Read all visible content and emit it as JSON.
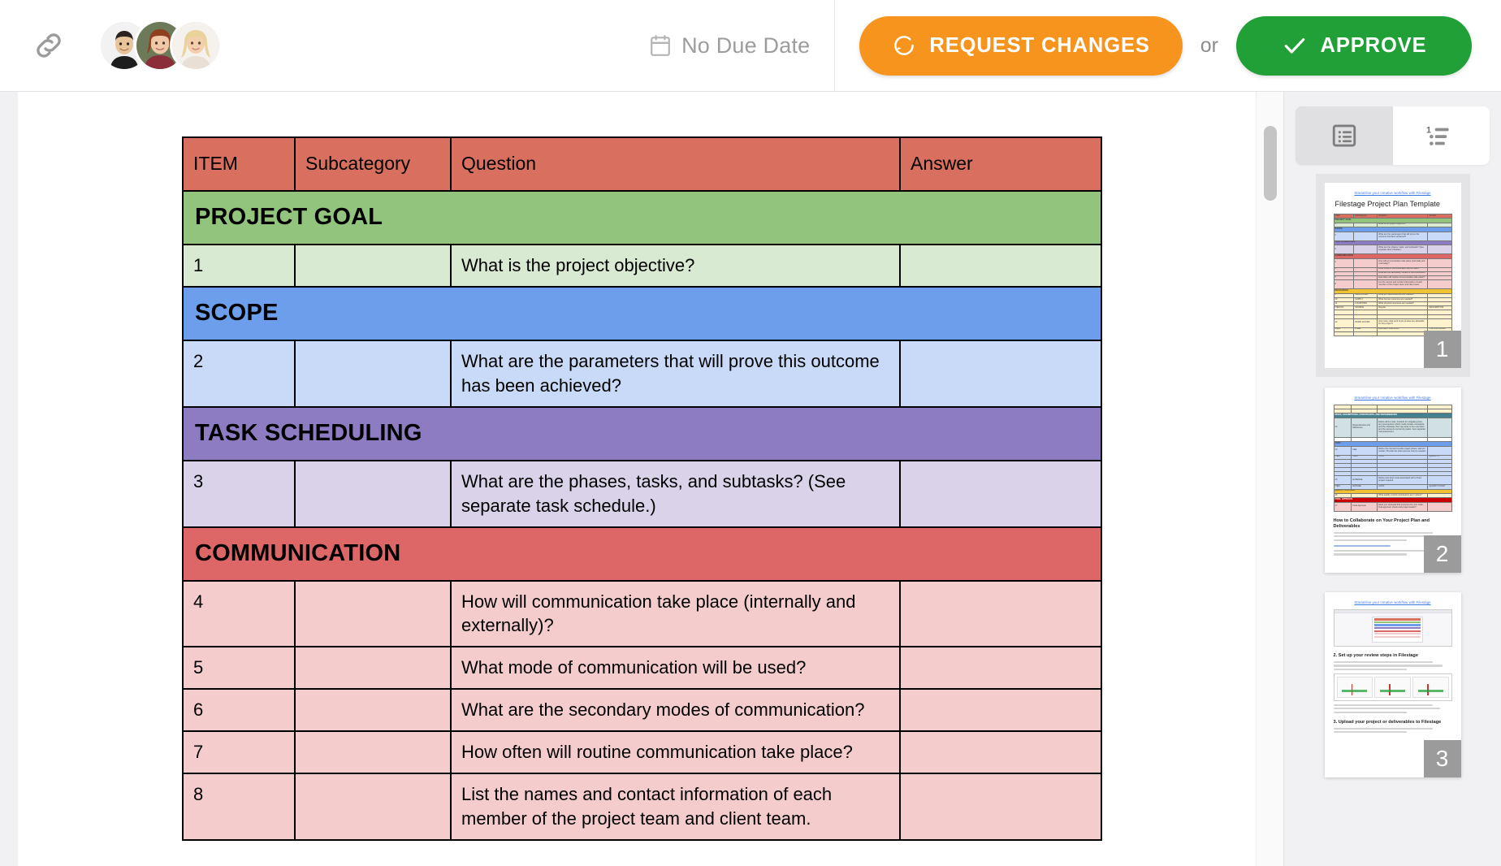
{
  "topbar": {
    "link_icon": "link-icon",
    "avatars": [
      {
        "name": "reviewer-1",
        "skin": "#e8c49a",
        "hair": "#2a2320",
        "shirt": "#1d1d1d",
        "bg": "#f2f2f2"
      },
      {
        "name": "reviewer-2",
        "skin": "#f0c8a8",
        "hair": "#8d3f1f",
        "shirt": "#8c2d3a",
        "bg": "#6d7a5a"
      },
      {
        "name": "reviewer-3",
        "skin": "#f3cfae",
        "hair": "#e8d39a",
        "shirt": "#e9dfd4",
        "bg": "#f5f2ee"
      }
    ],
    "due_date_label": "No Due Date",
    "due_date_icon": "calendar-icon",
    "request_changes_label": "REQUEST CHANGES",
    "request_changes_icon": "revision-arrow-icon",
    "request_changes_color": "#f7941e",
    "or_label": "or",
    "approve_label": "APPROVE",
    "approve_icon": "check-icon",
    "approve_color": "#21a038"
  },
  "document": {
    "table": {
      "columns": [
        "ITEM",
        "Subcategory",
        "Question",
        "Answer"
      ],
      "header_color": "#d9705f",
      "sections": [
        {
          "title": "PROJECT GOAL",
          "header_color": "#92c47d",
          "row_color": "#d9ead3",
          "rows": [
            {
              "item": "1",
              "subcategory": "",
              "question": "What is the project objective?",
              "answer": ""
            }
          ]
        },
        {
          "title": "SCOPE",
          "header_color": "#6d9eeb",
          "row_color": "#c9daf8",
          "rows": [
            {
              "item": "2",
              "subcategory": "",
              "question": "What are the parameters that will prove this outcome has been achieved?",
              "answer": ""
            }
          ]
        },
        {
          "title": "TASK SCHEDULING",
          "header_color": "#8e7cc3",
          "row_color": "#d9d2e9",
          "rows": [
            {
              "item": "3",
              "subcategory": "",
              "question": "What are the phases, tasks, and subtasks? (See separate task schedule.)",
              "answer": ""
            }
          ]
        },
        {
          "title": "COMMUNICATION",
          "header_color": "#dd6666",
          "row_color": "#f4cccc",
          "rows": [
            {
              "item": "4",
              "subcategory": "",
              "question": "How will communication take place (internally and externally)?",
              "answer": ""
            },
            {
              "item": "5",
              "subcategory": "",
              "question": "What mode of communication will be used?",
              "answer": ""
            },
            {
              "item": "6",
              "subcategory": "",
              "question": "What are the secondary modes of communication?",
              "answer": ""
            },
            {
              "item": "7",
              "subcategory": "",
              "question": "How often will routine communication take place?",
              "answer": ""
            },
            {
              "item": "8",
              "subcategory": "",
              "question": "List the names and contact information of each member of the project team and client team.",
              "answer": ""
            }
          ]
        }
      ]
    }
  },
  "rightpanel": {
    "tabs": [
      {
        "name": "comments-tab",
        "icon": "comment-list-icon",
        "active": false
      },
      {
        "name": "pages-tab",
        "icon": "numbered-list-icon",
        "active": true
      }
    ],
    "thumbnails": [
      {
        "number": "1",
        "selected": true,
        "link": "Streamline your creative workflow with Filestage",
        "title": "Filestage Project Plan Template"
      },
      {
        "number": "2",
        "selected": false,
        "link": "Streamline your creative workflow with Filestage",
        "heading": "How to Collaborate on Your Project Plan and Deliverables",
        "body_1": "Here's how you can streamline the review and approval process for your project plan AND all of the following project deliverables.",
        "step_1": "1. Request a free Filestage trial & demo here.",
        "step_2": "If, in the meantime, check out our library site and learn more about how to use Filestage to review project files."
      },
      {
        "number": "3",
        "selected": false,
        "link": "Streamline your creative workflow with Filestage",
        "step_2": "2. Set up your review steps in Filestage",
        "body_1": "Before you can start, you should replicate your existing review and approval processes in Filestage. Set up review steps to which review members your project plan (or several milestones) have to go through.",
        "body_2": "Each review step can involve different reviewers. For example, your first review step could be used to refine your showcase with your team while our second review step involves your client or management and ends with their approval.",
        "step_3": "3. Upload your project or deliverables to Filestage",
        "body_3": "Now, you have to upload your deliverable to Filestage by simply clicking on the UPLOAD FILE button."
      }
    ]
  }
}
